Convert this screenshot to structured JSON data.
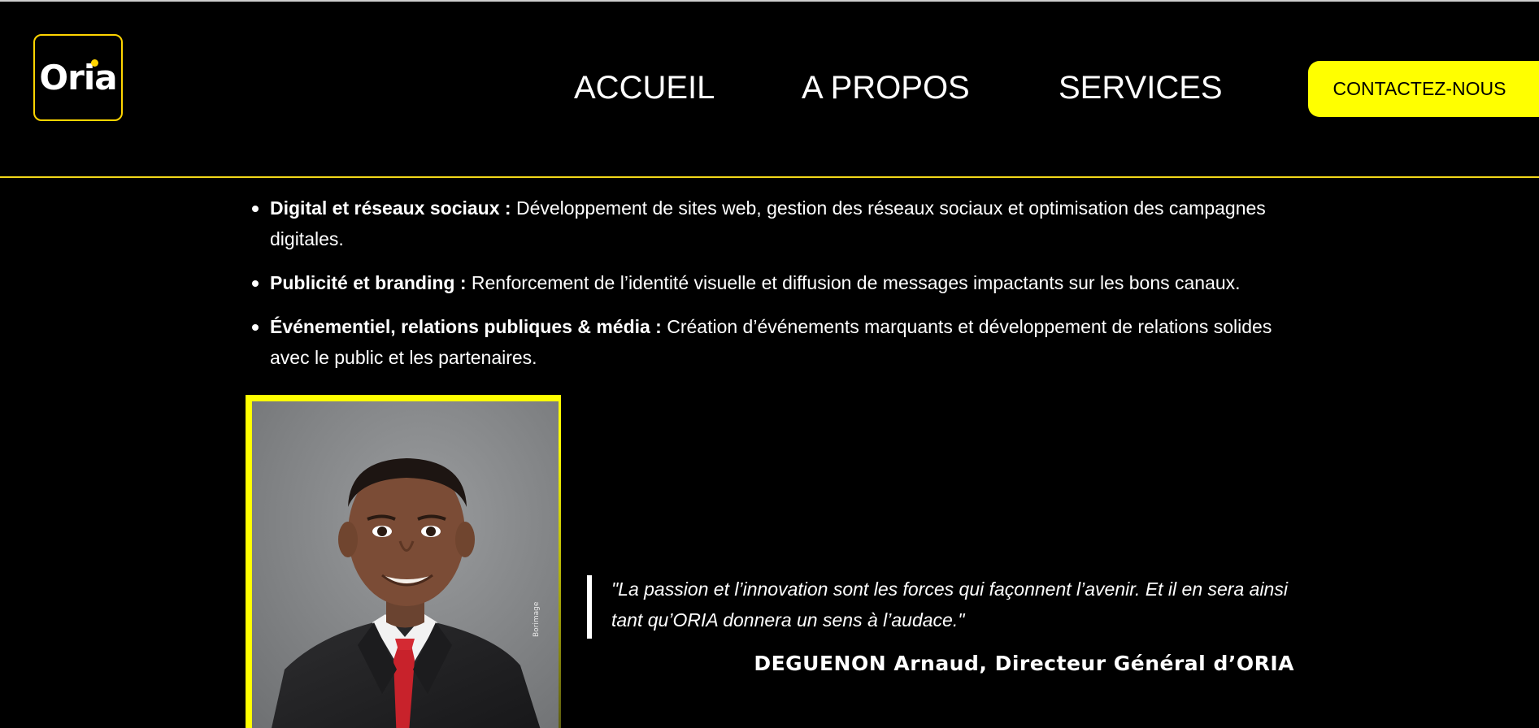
{
  "brand": {
    "logo_text": "Oria",
    "accent": "#ffff00",
    "logo_border": "#ffd500",
    "header_line": "#f3d81a"
  },
  "nav": {
    "items": [
      {
        "label": "ACCUEIL"
      },
      {
        "label": "A PROPOS"
      },
      {
        "label": "SERVICES"
      }
    ],
    "contact_label": "CONTACTEZ-NOUS"
  },
  "services": [
    {
      "title": "Digital et réseaux sociaux :",
      "text": " Développement de sites web, gestion des réseaux sociaux et optimisation des campagnes digitales."
    },
    {
      "title": "Publicité et branding :",
      "text": " Renforcement de l’identité visuelle et diffusion de messages impactants sur les bons canaux."
    },
    {
      "title": "Événementiel, relations publiques & média :",
      "text": " Création d’événements marquants et développement de relations solides avec le public et les partenaires."
    }
  ],
  "quote": {
    "text": "\"La passion et l’innovation sont les forces qui façonnent l’avenir. Et il en sera ainsi tant qu’ORIA donnera un sens à l’audace.\"",
    "author": "DEGUENON Arnaud, Directeur Général d’ORIA"
  },
  "photo": {
    "watermark": "Borimage"
  }
}
